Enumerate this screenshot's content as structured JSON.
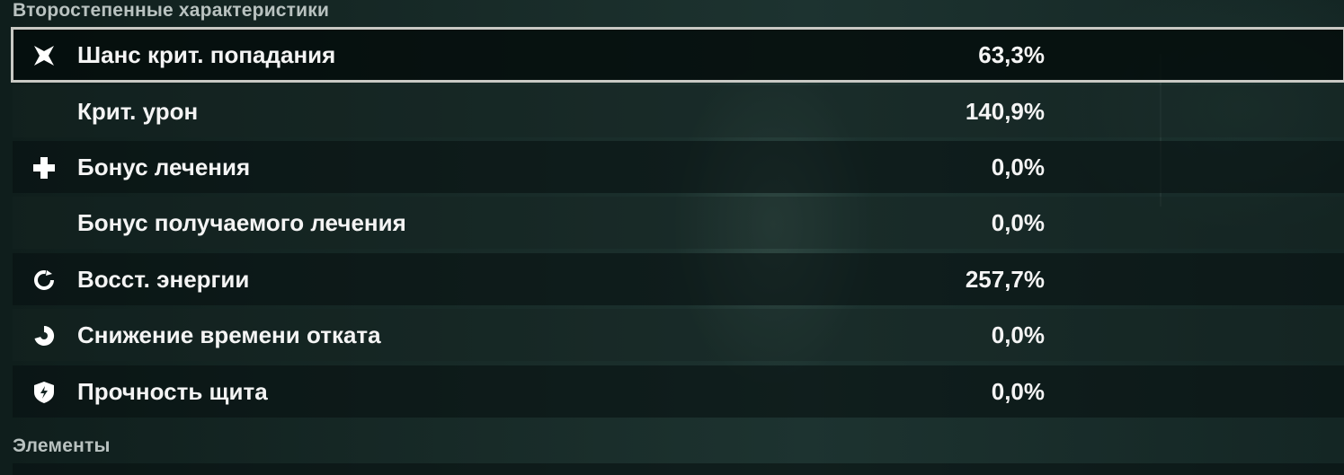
{
  "sections": {
    "secondary_title": "Второстепенные характеристики",
    "elements_title": "Элементы"
  },
  "stats": [
    {
      "icon": "crit-rate-icon",
      "label": "Шанс крит. попадания",
      "value": "63,3%",
      "selected": true
    },
    {
      "icon": "",
      "label": "Крит. урон",
      "value": "140,9%",
      "selected": false
    },
    {
      "icon": "healing-bonus-icon",
      "label": "Бонус лечения",
      "value": "0,0%",
      "selected": false
    },
    {
      "icon": "",
      "label": "Бонус получаемого лечения",
      "value": "0,0%",
      "selected": false
    },
    {
      "icon": "energy-recharge-icon",
      "label": "Восст. энергии",
      "value": "257,7%",
      "selected": false
    },
    {
      "icon": "cd-reduction-icon",
      "label": "Снижение времени отката",
      "value": "0,0%",
      "selected": false
    },
    {
      "icon": "shield-strength-icon",
      "label": "Прочность щита",
      "value": "0,0%",
      "selected": false
    }
  ]
}
